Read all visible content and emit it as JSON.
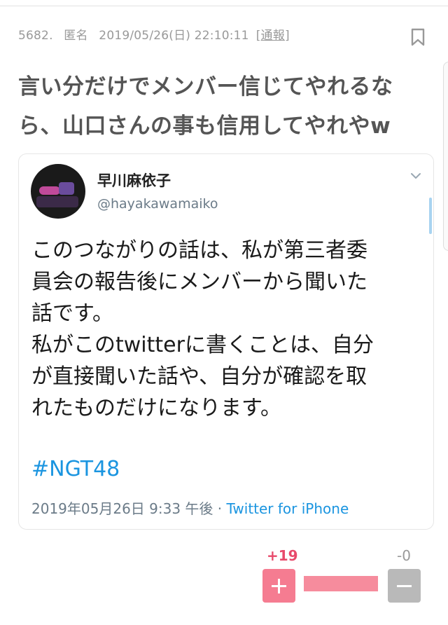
{
  "post": {
    "number": "5682.",
    "author": "匿名",
    "datetime": "2019/05/26(日) 22:10:11",
    "report_open": "[",
    "report_label": "通報",
    "report_close": "]",
    "title_line1": "言い分だけでメンバー信じてやれるな",
    "title_line2": "ら、山口さんの事も信用してやれやw"
  },
  "tweet": {
    "name": "早川麻依子",
    "handle": "@hayakawamaiko",
    "body_lines": [
      "このつながりの話は、私が第三者委",
      "員会の報告後にメンバーから聞いた",
      "話です。",
      "私がこのtwitterに書くことは、自分",
      "が直接聞いた話や、自分が確認を取",
      "れたものだけになります。"
    ],
    "hashtag": "#NGT48",
    "timestamp": "2019年05月26日 9:33 午後 · ",
    "source": "Twitter for iPhone"
  },
  "votes": {
    "plus": "+19",
    "minus": "-0",
    "plus_ratio": 1.0
  },
  "colors": {
    "accent_pink": "#f57c91",
    "plus_text": "#e84a6b",
    "link_blue": "#1b95e0",
    "minus_gray": "#b9b9b9"
  },
  "icons": [
    "bookmark-icon",
    "chevron-down-icon",
    "plus-icon",
    "minus-icon"
  ]
}
